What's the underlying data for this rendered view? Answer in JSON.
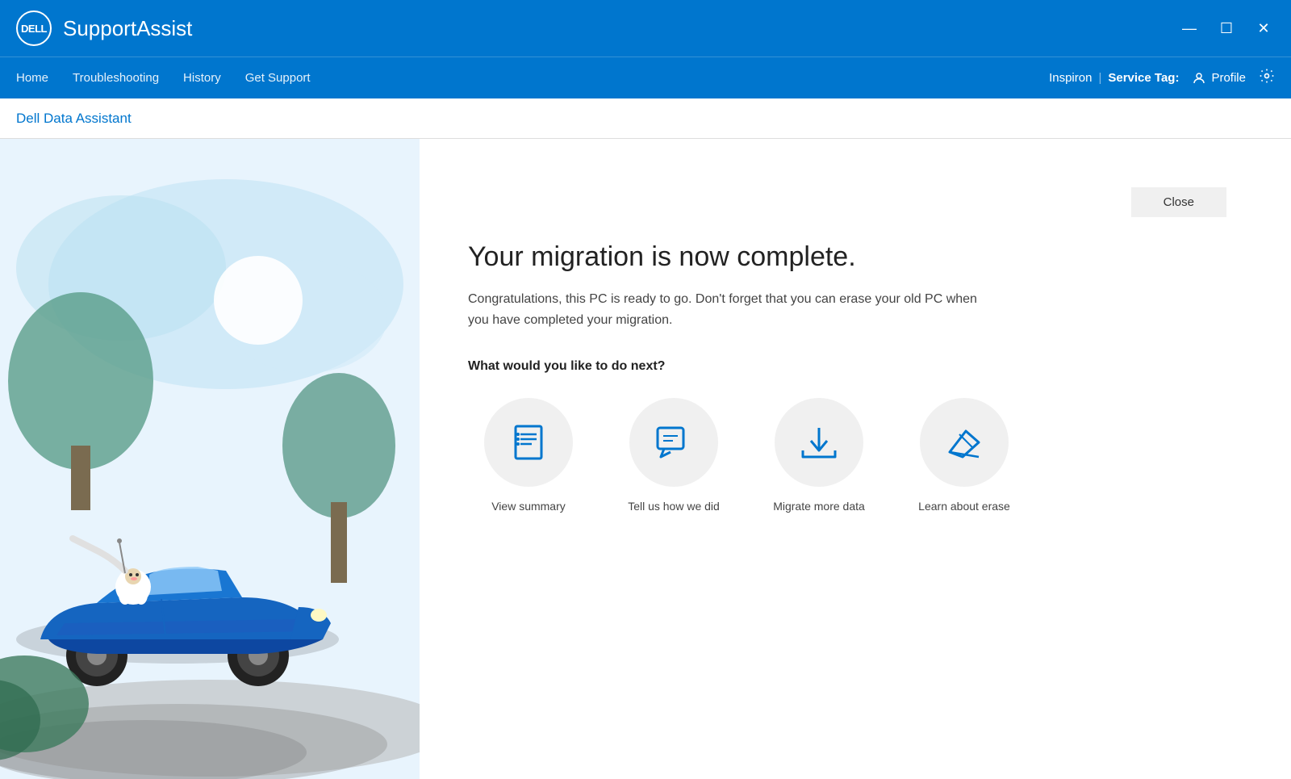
{
  "titleBar": {
    "logo": "DELL",
    "appName": "SupportAssist",
    "minimizeLabel": "—",
    "maximizeLabel": "☐",
    "closeLabel": "✕"
  },
  "navBar": {
    "links": [
      {
        "id": "home",
        "label": "Home"
      },
      {
        "id": "troubleshooting",
        "label": "Troubleshooting"
      },
      {
        "id": "history",
        "label": "History"
      },
      {
        "id": "get-support",
        "label": "Get Support"
      }
    ],
    "deviceName": "Inspiron",
    "serviceTagPrefix": "Service Tag:",
    "serviceTagValue": "",
    "profileLabel": "Profile",
    "divider": "|"
  },
  "subHeader": {
    "title": "Dell Data Assistant"
  },
  "mainContent": {
    "closeBtnLabel": "Close",
    "migrationTitle": "Your migration is now complete.",
    "migrationSubtitle": "Congratulations, this PC is ready to go. Don't forget that you can erase your old PC when you have completed your migration.",
    "nextLabel": "What would you like to do next?",
    "actions": [
      {
        "id": "view-summary",
        "label": "View summary",
        "icon": "summary"
      },
      {
        "id": "tell-us",
        "label": "Tell us how we did",
        "icon": "feedback"
      },
      {
        "id": "migrate-more",
        "label": "Migrate more data",
        "icon": "migrate"
      },
      {
        "id": "learn-erase",
        "label": "Learn about erase",
        "icon": "erase"
      }
    ]
  }
}
